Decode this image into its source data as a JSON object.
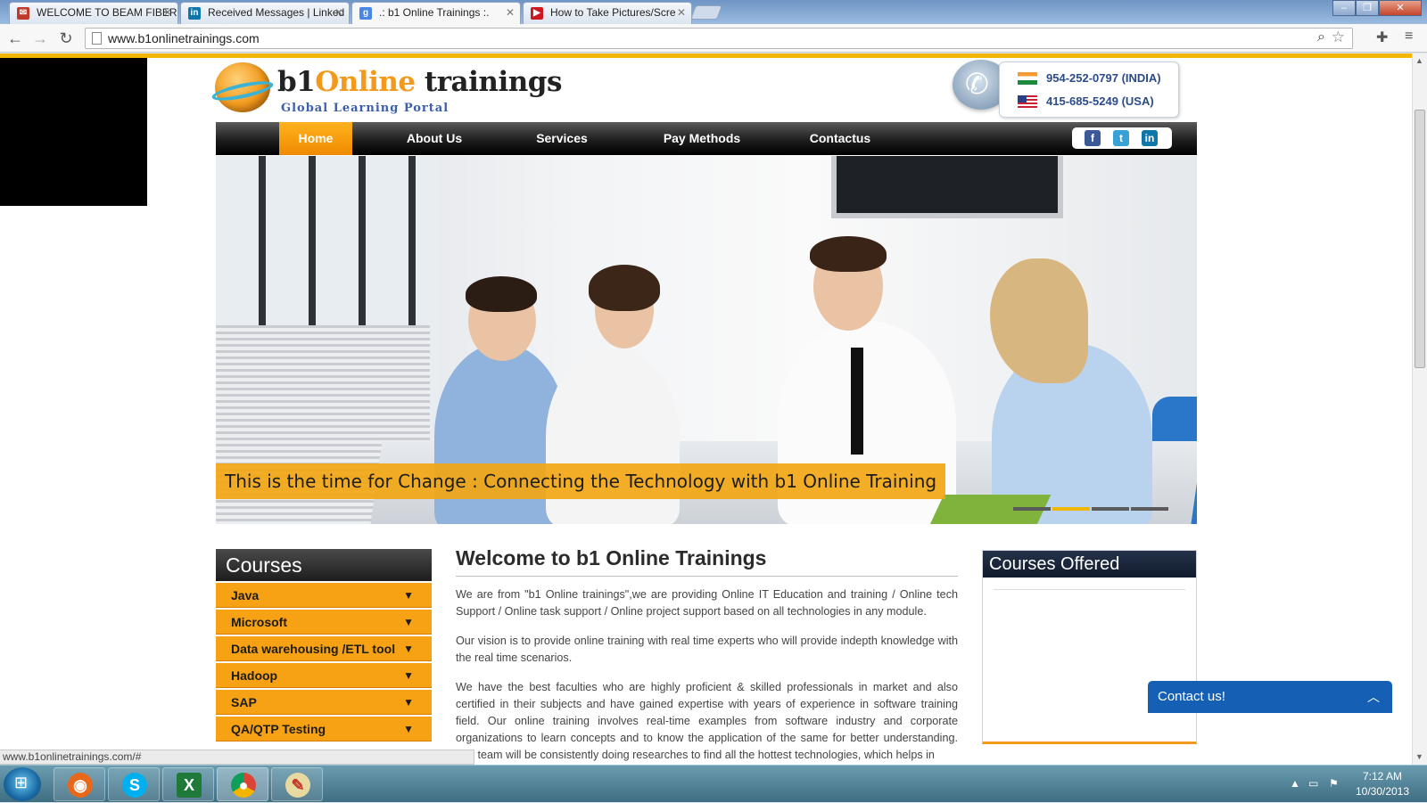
{
  "browser": {
    "tabs": [
      {
        "title": "WELCOME TO BEAM FIBER",
        "icon": "beam-favicon",
        "color": "#c0392b"
      },
      {
        "title": "Received Messages | Linked",
        "icon": "linkedin-favicon",
        "color": "#0e76a8"
      },
      {
        "title": ".: b1 Online Trainings :.",
        "icon": "google-favicon",
        "color": "#4a86e8"
      },
      {
        "title": "How to Take Pictures/Scre",
        "icon": "youtube-favicon",
        "color": "#cc181e"
      }
    ],
    "url": "www.b1onlinetrainings.com",
    "status_url": "www.b1onlinetrainings.com/#"
  },
  "site": {
    "logo": {
      "name_part1": "b1",
      "name_part2": "Online",
      "name_part3": " trainings",
      "tagline": "Global Learning Portal"
    },
    "phones": [
      {
        "country": "INDIA",
        "number": "954-252-0797 (INDIA)",
        "flag": "india-flag"
      },
      {
        "country": "USA",
        "number": "415-685-5249 (USA)",
        "flag": "usa-flag"
      }
    ],
    "nav": [
      "Home",
      "About Us",
      "Services",
      "Pay Methods",
      "Contactus"
    ],
    "social": [
      "facebook-icon",
      "twitter-icon",
      "linkedin-icon"
    ],
    "hero_caption": "This is the time for Change : Connecting the Technology with b1 Online Training",
    "slider": {
      "count": 4,
      "active_index": 1
    },
    "courses": {
      "heading": "Courses",
      "items": [
        "Java",
        "Microsoft",
        "Data warehousing /ETL tool",
        "Hadoop",
        "SAP",
        "QA/QTP Testing"
      ]
    },
    "welcome": {
      "title": "Welcome to b1 Online Trainings",
      "paragraphs": [
        "We are from \"b1 Online trainings\",we are providing Online IT Education and training / Online tech Support / Online task support / Online project support based on all technologies in any module.",
        "Our vision is to provide online training with real time experts who will provide indepth knowledge with the real time scenarios.",
        "We have the best faculties who are highly proficient & skilled professionals in market and also certified in their subjects and have gained expertise with years of experience in software training field. Our online training involves real-time examples from software industry and corporate organizations to learn concepts and to know the application of the same for better understanding. Our team will be consistently doing researches to find all the hottest technologies, which helps in"
      ]
    },
    "courses_offered": {
      "heading": "Courses Offered"
    },
    "contact_widget": {
      "label": "Contact us!"
    }
  },
  "taskbar": {
    "apps": [
      "firefox-icon",
      "skype-icon",
      "excel-icon",
      "chrome-icon",
      "paint-icon"
    ],
    "time": "7:12 AM",
    "date": "10/30/2013"
  },
  "colors": {
    "accent": "#f7a114",
    "nav_active": "#f08a00",
    "brand_blue": "#2b4b8a",
    "contact_blue": "#1560b4"
  }
}
